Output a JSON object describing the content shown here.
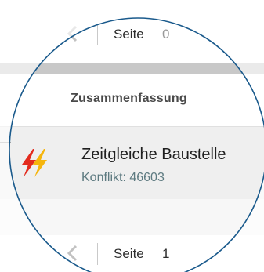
{
  "pager_top": {
    "label": "Seite",
    "page": "0"
  },
  "summary": {
    "title": "Zusammenfassung"
  },
  "conflict_item": {
    "title": "Zeitgleiche Baustelle",
    "subtitle": "Konflikt: 46603",
    "icon": "double-lightning-icon",
    "icon_colors": [
      "#e32b1e",
      "#f5b50d"
    ]
  },
  "pager_bottom": {
    "label": "Seite",
    "page": "1"
  },
  "colors": {
    "outline": "#1a5a8c",
    "gray_band": "#c8c8c8",
    "item_background": "#efefef",
    "subtitle": "#5d7a80"
  }
}
